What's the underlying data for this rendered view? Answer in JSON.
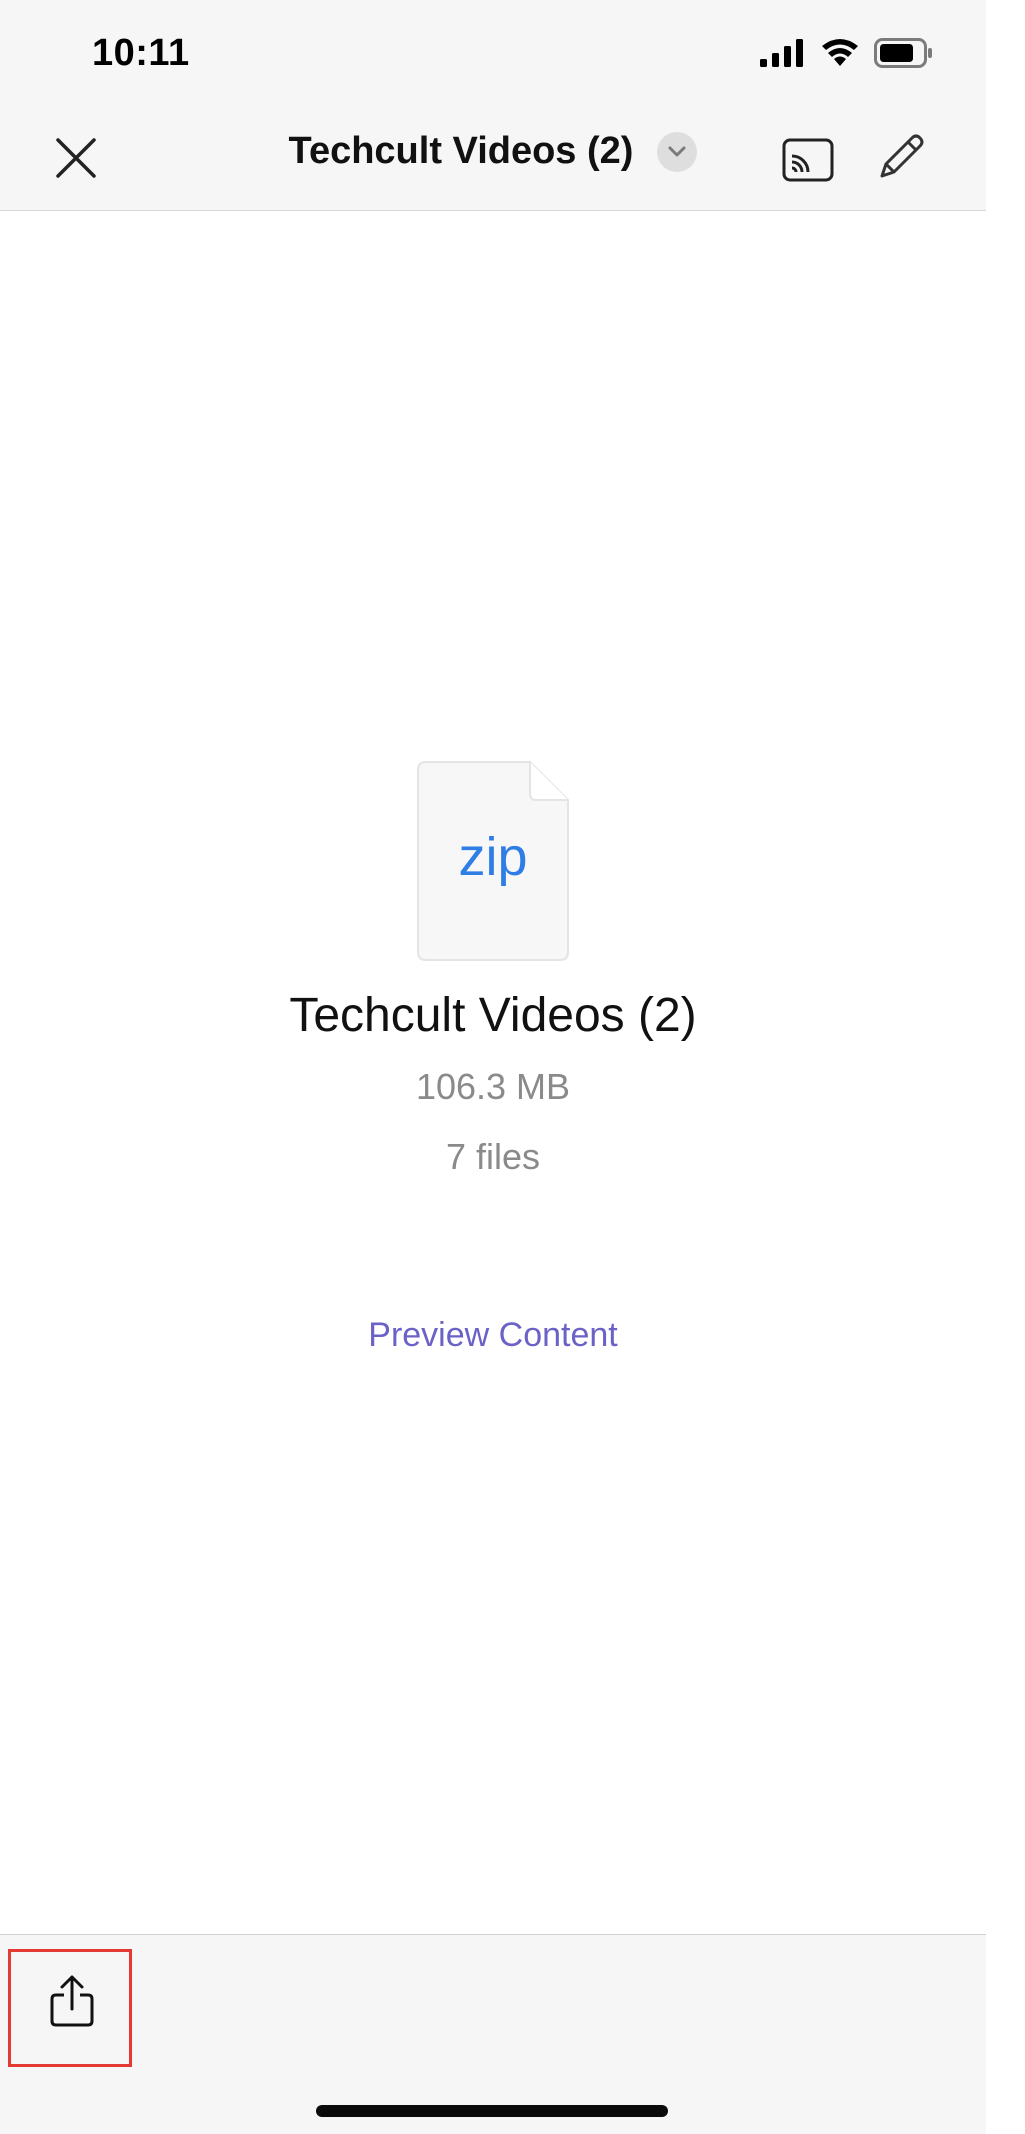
{
  "status_bar": {
    "time": "10:11"
  },
  "nav": {
    "title": "Techcult Videos (2)",
    "icons": [
      "close-icon",
      "chevron-down-icon",
      "cast-icon",
      "pencil-icon"
    ]
  },
  "file": {
    "extension": "zip",
    "name": "Techcult Videos (2)",
    "size": "106.3 MB",
    "count": "7 files"
  },
  "actions": {
    "preview_label": "Preview Content"
  },
  "toolbar": {
    "icons": [
      "share-icon"
    ]
  },
  "colors": {
    "accent_link": "#6a62c6",
    "zip_text": "#2f7ee6",
    "highlight_border": "#e53935"
  }
}
